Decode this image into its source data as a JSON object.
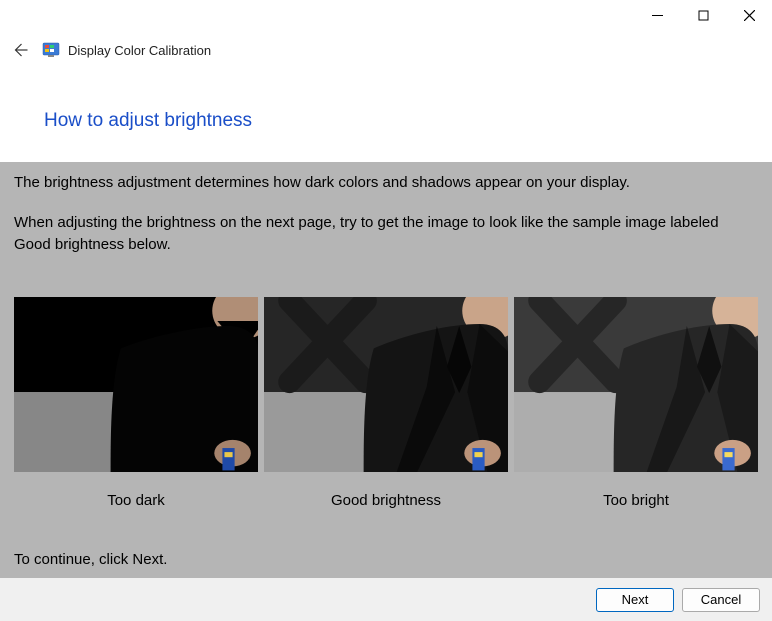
{
  "window": {
    "app_title": "Display Color Calibration"
  },
  "page": {
    "heading": "How to adjust brightness",
    "intro1": "The brightness adjustment determines how dark colors and shadows appear on your display.",
    "intro2": "When adjusting the brightness on the next page, try to get the image to look like the sample image labeled Good brightness below.",
    "continue": "To continue, click Next."
  },
  "samples": [
    {
      "caption": "Too dark"
    },
    {
      "caption": "Good brightness"
    },
    {
      "caption": "Too bright"
    }
  ],
  "footer": {
    "next_label": "Next",
    "cancel_label": "Cancel"
  }
}
